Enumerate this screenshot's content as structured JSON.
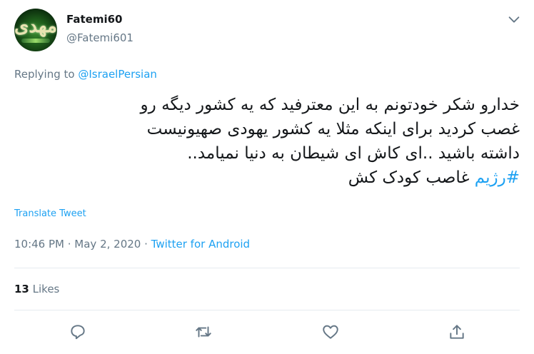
{
  "tweet": {
    "author": {
      "display_name": "Fatemi60",
      "handle": "@Fatemi601"
    },
    "replying": {
      "prefix": "Replying to ",
      "mention": "@IsraelPersian"
    },
    "text_lines": [
      "خدارو شکر خودتونم به این معترفید که یه کشور دیگه رو",
      "غصب کردید برای اینکه مثلا یه کشور یهودی صهیونیست",
      "داشته باشید ..ای کاش ای شیطان به دنیا نمیامد.."
    ],
    "hashtag": "#رژیم",
    "last_line_text": "غاصب کودک کش",
    "translate_label": "Translate Tweet",
    "timestamp": "10:46 PM · May 2, 2020",
    "separator": " · ",
    "source": "Twitter for Android",
    "likes": {
      "count": "13",
      "label": "Likes"
    }
  },
  "icons": {
    "menu": "chevron-down-icon",
    "reply": "reply-icon",
    "retweet": "retweet-icon",
    "like": "like-icon",
    "share": "share-icon"
  },
  "colors": {
    "link": "#1da1f2",
    "secondary_text": "#657786",
    "primary_text": "#14171a",
    "divider": "#e6ecf0",
    "icon": "#657786"
  }
}
